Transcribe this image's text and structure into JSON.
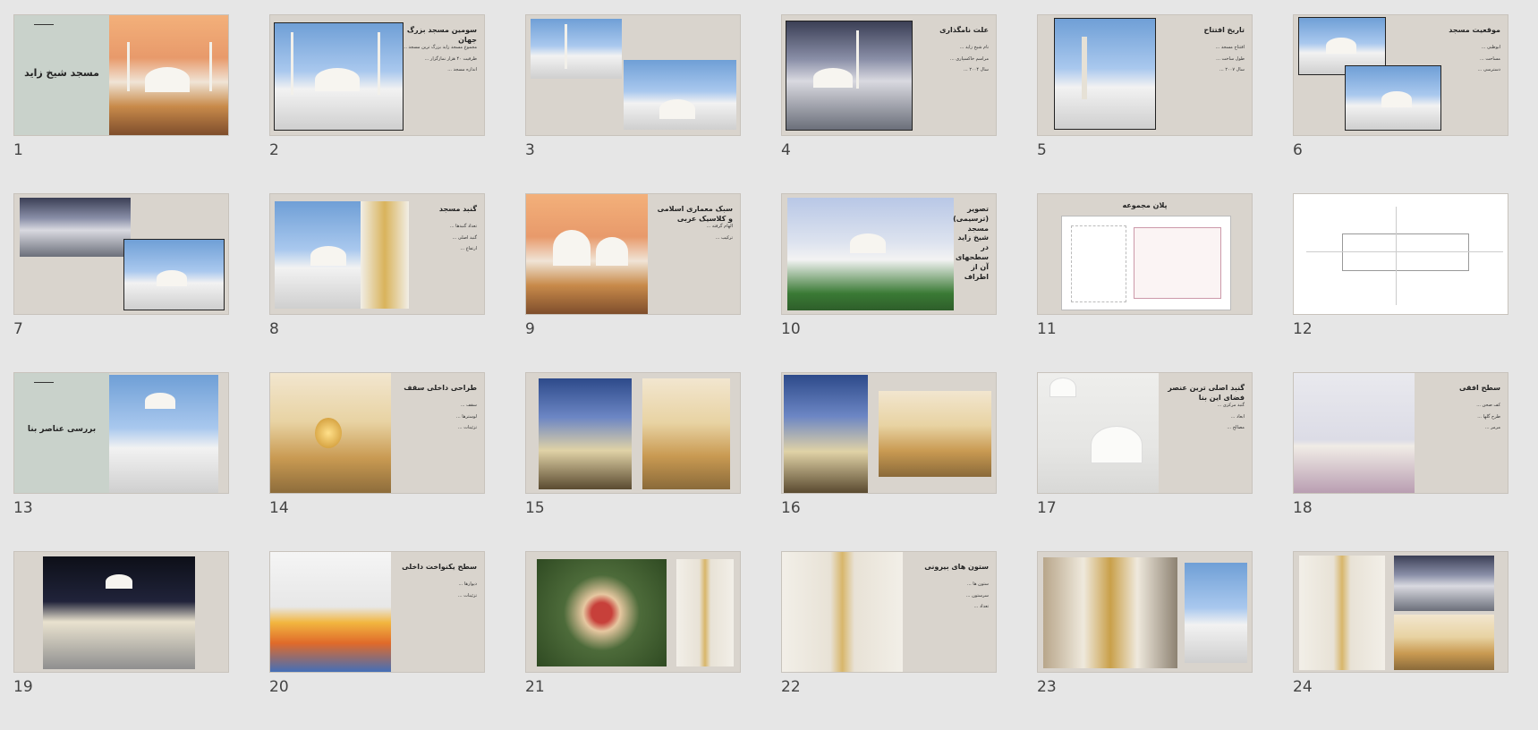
{
  "slides": [
    {
      "number": "1",
      "title": "مسجد شیخ زاید",
      "bullets": []
    },
    {
      "number": "2",
      "title": "سومین مسجد بزرگ جهان",
      "bullets": [
        "مجموع مسجد زاید بزرگ ترین مسجد ...",
        "ظرفیت ۴۰ هزار نمازگزار ...",
        "اندازه مسجد ..."
      ]
    },
    {
      "number": "3",
      "title": "",
      "bullets": []
    },
    {
      "number": "4",
      "title": "علت نامگذاری",
      "bullets": [
        "نام شیخ زاید ...",
        "مراسم خاکسپاری ...",
        "سال ۲۰۰۴ ..."
      ]
    },
    {
      "number": "5",
      "title": "تاریخ افتتاح",
      "bullets": [
        "افتتاح مسجد ...",
        "طول ساخت ...",
        "سال ۲۰۰۷ ..."
      ]
    },
    {
      "number": "6",
      "title": "موقعیت مسجد",
      "bullets": [
        "ابوظبی ...",
        "مساحت ...",
        "دسترسی ..."
      ]
    },
    {
      "number": "7",
      "title": "",
      "bullets": []
    },
    {
      "number": "8",
      "title": "گنبد مسجد",
      "bullets": [
        "تعداد گنبدها ...",
        "گنبد اصلی ...",
        "ارتفاع ..."
      ]
    },
    {
      "number": "9",
      "title": "سبک معماری اسلامی و کلاسیک عربی",
      "bullets": [
        "الهام گرفته ...",
        "ترکیب ..."
      ]
    },
    {
      "number": "10",
      "title": "تصویر (ترسیمی) مسجد شیخ زاید در سطحهای آن از اطراف",
      "bullets": []
    },
    {
      "number": "11",
      "title": "پلان مجموعه",
      "bullets": []
    },
    {
      "number": "12",
      "title": "",
      "bullets": []
    },
    {
      "number": "13",
      "title": "بررسی عناصر بنا",
      "bullets": []
    },
    {
      "number": "14",
      "title": "طراحی داخلی سقف",
      "bullets": [
        "سقف ...",
        "لوسترها ...",
        "تزئینات ..."
      ]
    },
    {
      "number": "15",
      "title": "",
      "bullets": []
    },
    {
      "number": "16",
      "title": "",
      "bullets": []
    },
    {
      "number": "17",
      "title": "گنبد اصلی ترین عنصر فضای این بنا",
      "bullets": [
        "گنبد مرکزی ...",
        "ابعاد ...",
        "مصالح ..."
      ]
    },
    {
      "number": "18",
      "title": "سطح افقی",
      "bullets": [
        "کف صحن ...",
        "طرح گلها ...",
        "مرمر ..."
      ]
    },
    {
      "number": "19",
      "title": "",
      "bullets": []
    },
    {
      "number": "20",
      "title": "سطح یکنواخت داخلی",
      "bullets": [
        "دیوارها ...",
        "تزئینات ..."
      ]
    },
    {
      "number": "21",
      "title": "",
      "bullets": []
    },
    {
      "number": "22",
      "title": "ستون های بیرونی",
      "bullets": [
        "ستون ها ...",
        "سرستون ...",
        "تعداد ..."
      ]
    },
    {
      "number": "23",
      "title": "",
      "bullets": []
    },
    {
      "number": "24",
      "title": "",
      "bullets": []
    }
  ]
}
